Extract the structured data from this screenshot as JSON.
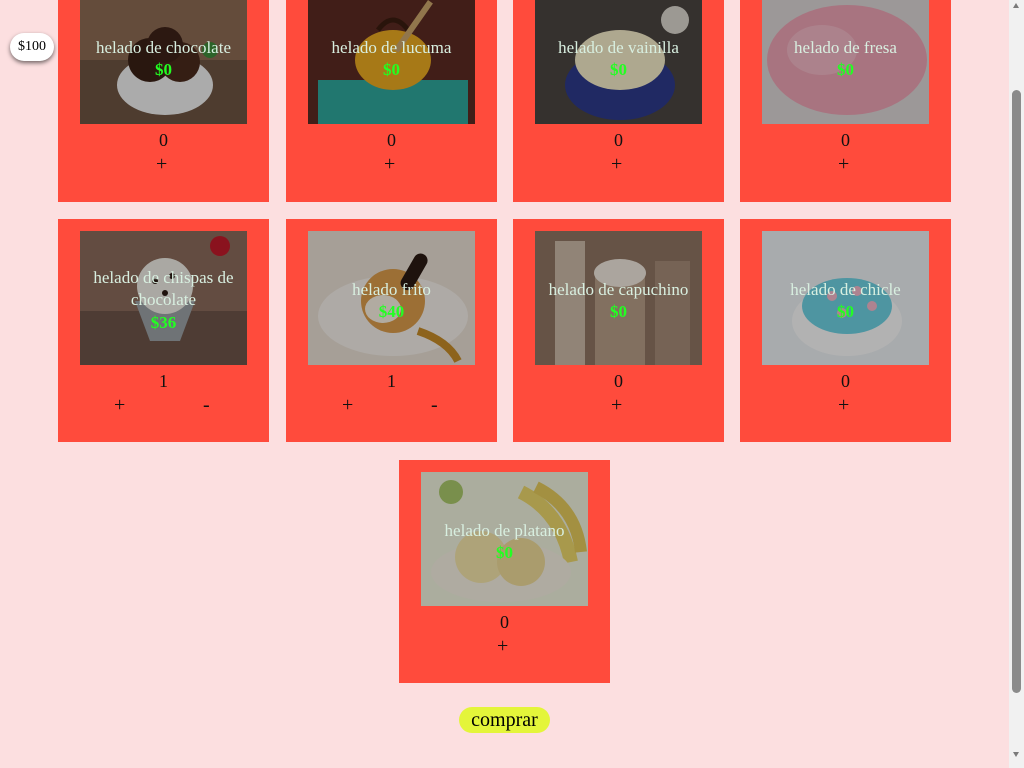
{
  "wallet": {
    "balance": "$100"
  },
  "products": [
    {
      "name": "helado de chocolate",
      "price": "$0",
      "qty": "0",
      "plus": "+",
      "minus": ""
    },
    {
      "name": "helado de lucuma",
      "price": "$0",
      "qty": "0",
      "plus": "+",
      "minus": ""
    },
    {
      "name": "helado de vainilla",
      "price": "$0",
      "qty": "0",
      "plus": "+",
      "minus": ""
    },
    {
      "name": "helado de fresa",
      "price": "$0",
      "qty": "0",
      "plus": "+",
      "minus": ""
    },
    {
      "name": "helado de chispas de chocolate",
      "price": "$36",
      "qty": "1",
      "plus": "+",
      "minus": "-"
    },
    {
      "name": "helado frito",
      "price": "$40",
      "qty": "1",
      "plus": "+",
      "minus": "-"
    },
    {
      "name": "helado de capuchino",
      "price": "$0",
      "qty": "0",
      "plus": "+",
      "minus": ""
    },
    {
      "name": "helado de chicle",
      "price": "$0",
      "qty": "0",
      "plus": "+",
      "minus": ""
    },
    {
      "name": "helado de platano",
      "price": "$0",
      "qty": "0",
      "plus": "+",
      "minus": ""
    }
  ],
  "actions": {
    "buy_label": "comprar"
  },
  "colors": {
    "page_bg": "#fcdfe0",
    "card_bg": "#ff4b3c",
    "price": "#22ff22",
    "buy_button": "#e4f53a"
  },
  "icons": {
    "plus": "plus-icon",
    "minus": "minus-icon"
  }
}
